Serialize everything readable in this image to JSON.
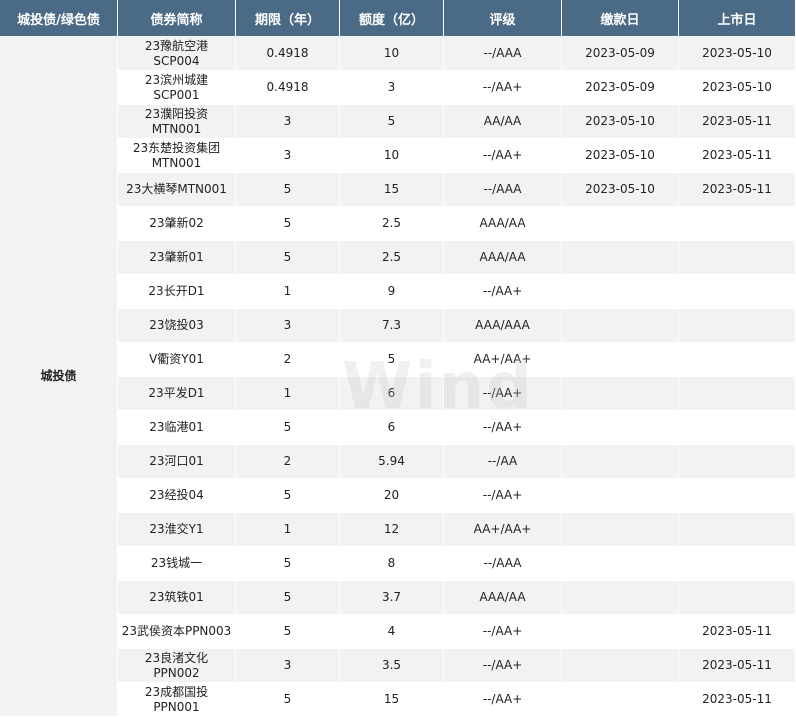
{
  "headers": [
    "城投债/绿色债",
    "债券简称",
    "期限（年）",
    "额度（亿）",
    "评级",
    "缴款日",
    "上市日"
  ],
  "group_label": "城投债",
  "rows": [
    {
      "name": [
        "23豫航空港",
        "SCP004"
      ],
      "term": "0.4918",
      "amount": "10",
      "rating": "--/AAA",
      "pay_date": "2023-05-09",
      "list_date": "2023-05-10"
    },
    {
      "name": [
        "23滨州城建",
        "SCP001"
      ],
      "term": "0.4918",
      "amount": "3",
      "rating": "--/AA+",
      "pay_date": "2023-05-09",
      "list_date": "2023-05-10"
    },
    {
      "name": [
        "23濮阳投资",
        "MTN001"
      ],
      "term": "3",
      "amount": "5",
      "rating": "AA/AA",
      "pay_date": "2023-05-10",
      "list_date": "2023-05-11"
    },
    {
      "name": [
        "23东楚投资集团",
        "MTN001"
      ],
      "term": "3",
      "amount": "10",
      "rating": "--/AA+",
      "pay_date": "2023-05-10",
      "list_date": "2023-05-11"
    },
    {
      "name": [
        "23大横琴MTN001"
      ],
      "term": "5",
      "amount": "15",
      "rating": "--/AAA",
      "pay_date": "2023-05-10",
      "list_date": "2023-05-11"
    },
    {
      "name": [
        "23肇新02"
      ],
      "term": "5",
      "amount": "2.5",
      "rating": "AAA/AA",
      "pay_date": "",
      "list_date": ""
    },
    {
      "name": [
        "23肇新01"
      ],
      "term": "5",
      "amount": "2.5",
      "rating": "AAA/AA",
      "pay_date": "",
      "list_date": ""
    },
    {
      "name": [
        "23长开D1"
      ],
      "term": "1",
      "amount": "9",
      "rating": "--/AA+",
      "pay_date": "",
      "list_date": ""
    },
    {
      "name": [
        "23饶投03"
      ],
      "term": "3",
      "amount": "7.3",
      "rating": "AAA/AAA",
      "pay_date": "",
      "list_date": ""
    },
    {
      "name": [
        "V衢资Y01"
      ],
      "term": "2",
      "amount": "5",
      "rating": "AA+/AA+",
      "pay_date": "",
      "list_date": ""
    },
    {
      "name": [
        "23平发D1"
      ],
      "term": "1",
      "amount": "6",
      "rating": "--/AA+",
      "pay_date": "",
      "list_date": ""
    },
    {
      "name": [
        "23临港01"
      ],
      "term": "5",
      "amount": "6",
      "rating": "--/AA+",
      "pay_date": "",
      "list_date": ""
    },
    {
      "name": [
        "23河口01"
      ],
      "term": "2",
      "amount": "5.94",
      "rating": "--/AA",
      "pay_date": "",
      "list_date": ""
    },
    {
      "name": [
        "23经投04"
      ],
      "term": "5",
      "amount": "20",
      "rating": "--/AA+",
      "pay_date": "",
      "list_date": ""
    },
    {
      "name": [
        "23淮交Y1"
      ],
      "term": "1",
      "amount": "12",
      "rating": "AA+/AA+",
      "pay_date": "",
      "list_date": ""
    },
    {
      "name": [
        "23钱城一"
      ],
      "term": "5",
      "amount": "8",
      "rating": "--/AAA",
      "pay_date": "",
      "list_date": ""
    },
    {
      "name": [
        "23筑铁01"
      ],
      "term": "5",
      "amount": "3.7",
      "rating": "AAA/AA",
      "pay_date": "",
      "list_date": ""
    },
    {
      "name": [
        "23武侯资本PPN003"
      ],
      "term": "5",
      "amount": "4",
      "rating": "--/AA+",
      "pay_date": "",
      "list_date": "2023-05-11"
    },
    {
      "name": [
        "23良渚文化",
        "PPN002"
      ],
      "term": "3",
      "amount": "3.5",
      "rating": "--/AA+",
      "pay_date": "",
      "list_date": "2023-05-11"
    },
    {
      "name": [
        "23成都国投",
        "PPN001"
      ],
      "term": "5",
      "amount": "15",
      "rating": "--/AA+",
      "pay_date": "",
      "list_date": "2023-05-11"
    }
  ],
  "watermark": "Wind"
}
